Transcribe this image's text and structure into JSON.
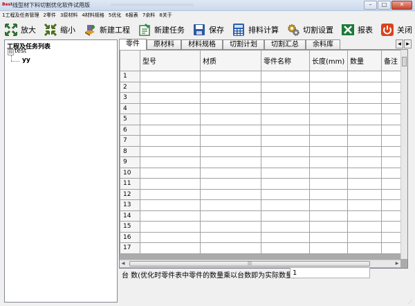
{
  "window": {
    "badge": "Best",
    "title": "线型材下料切割优化软件试用版",
    "minimize": "–",
    "maximize": "□",
    "close": "✕"
  },
  "menu": [
    "1工程及任务管理",
    "2零件",
    "3原材料",
    "4材料规格",
    "5优化",
    "6报表",
    "7余料",
    "8关于"
  ],
  "toolbar": {
    "zoom_in": "放大",
    "zoom_out": "缩小",
    "new_project": "新建工程",
    "new_task": "新建任务",
    "save": "保存",
    "nesting_calc": "排料计算",
    "cut_settings": "切割设置",
    "report": "报表",
    "close": "关闭"
  },
  "tree": {
    "header": "工程及任务列表",
    "expander": "⊟",
    "project": "test",
    "task": "yy"
  },
  "tabs": [
    "零件",
    "原材料",
    "材料规格",
    "切割计划",
    "切割汇总",
    "余料库"
  ],
  "tab_nav": {
    "left": "◀",
    "right": "▶"
  },
  "grid": {
    "columns": [
      "型号",
      "材质",
      "零件名称",
      "长度(mm)",
      "数量",
      "备注"
    ],
    "rows": [
      "1",
      "2",
      "3",
      "4",
      "5",
      "6",
      "7",
      "8",
      "9",
      "10",
      "11",
      "12",
      "13",
      "14",
      "15",
      "16",
      "17"
    ]
  },
  "hscroll": {
    "left": "◀",
    "right": "▶",
    "grip": "|||"
  },
  "quantity": {
    "label": "台 数(优化时零件表中零件的数量乘以台数即为实际数量)",
    "value": "1"
  },
  "colors": {
    "title_bar": "#c9d9ee",
    "close_red": "#c8462f",
    "grid_bg": "#ababab"
  }
}
